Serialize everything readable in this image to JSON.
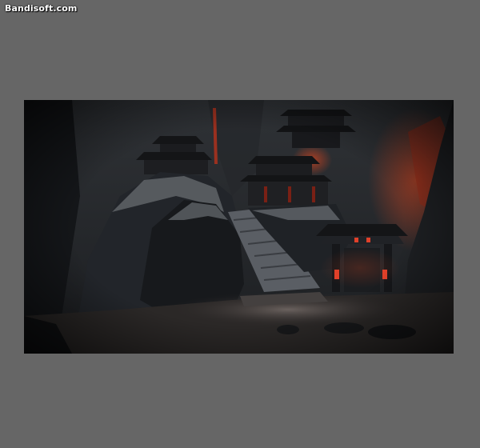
{
  "watermark": {
    "text": "Bandisoft.com"
  },
  "image": {
    "subject": "dark-temple-mountain-artwork",
    "colors": {
      "page_background": "#666666",
      "sky": "#2a2d31",
      "rock_dark": "#15171a",
      "rock_mid": "#2c3035",
      "snow": "#8b8f94",
      "lava_glow": "#c2361c",
      "lantern": "#e0402a",
      "ground_light": "#6e6461"
    }
  }
}
